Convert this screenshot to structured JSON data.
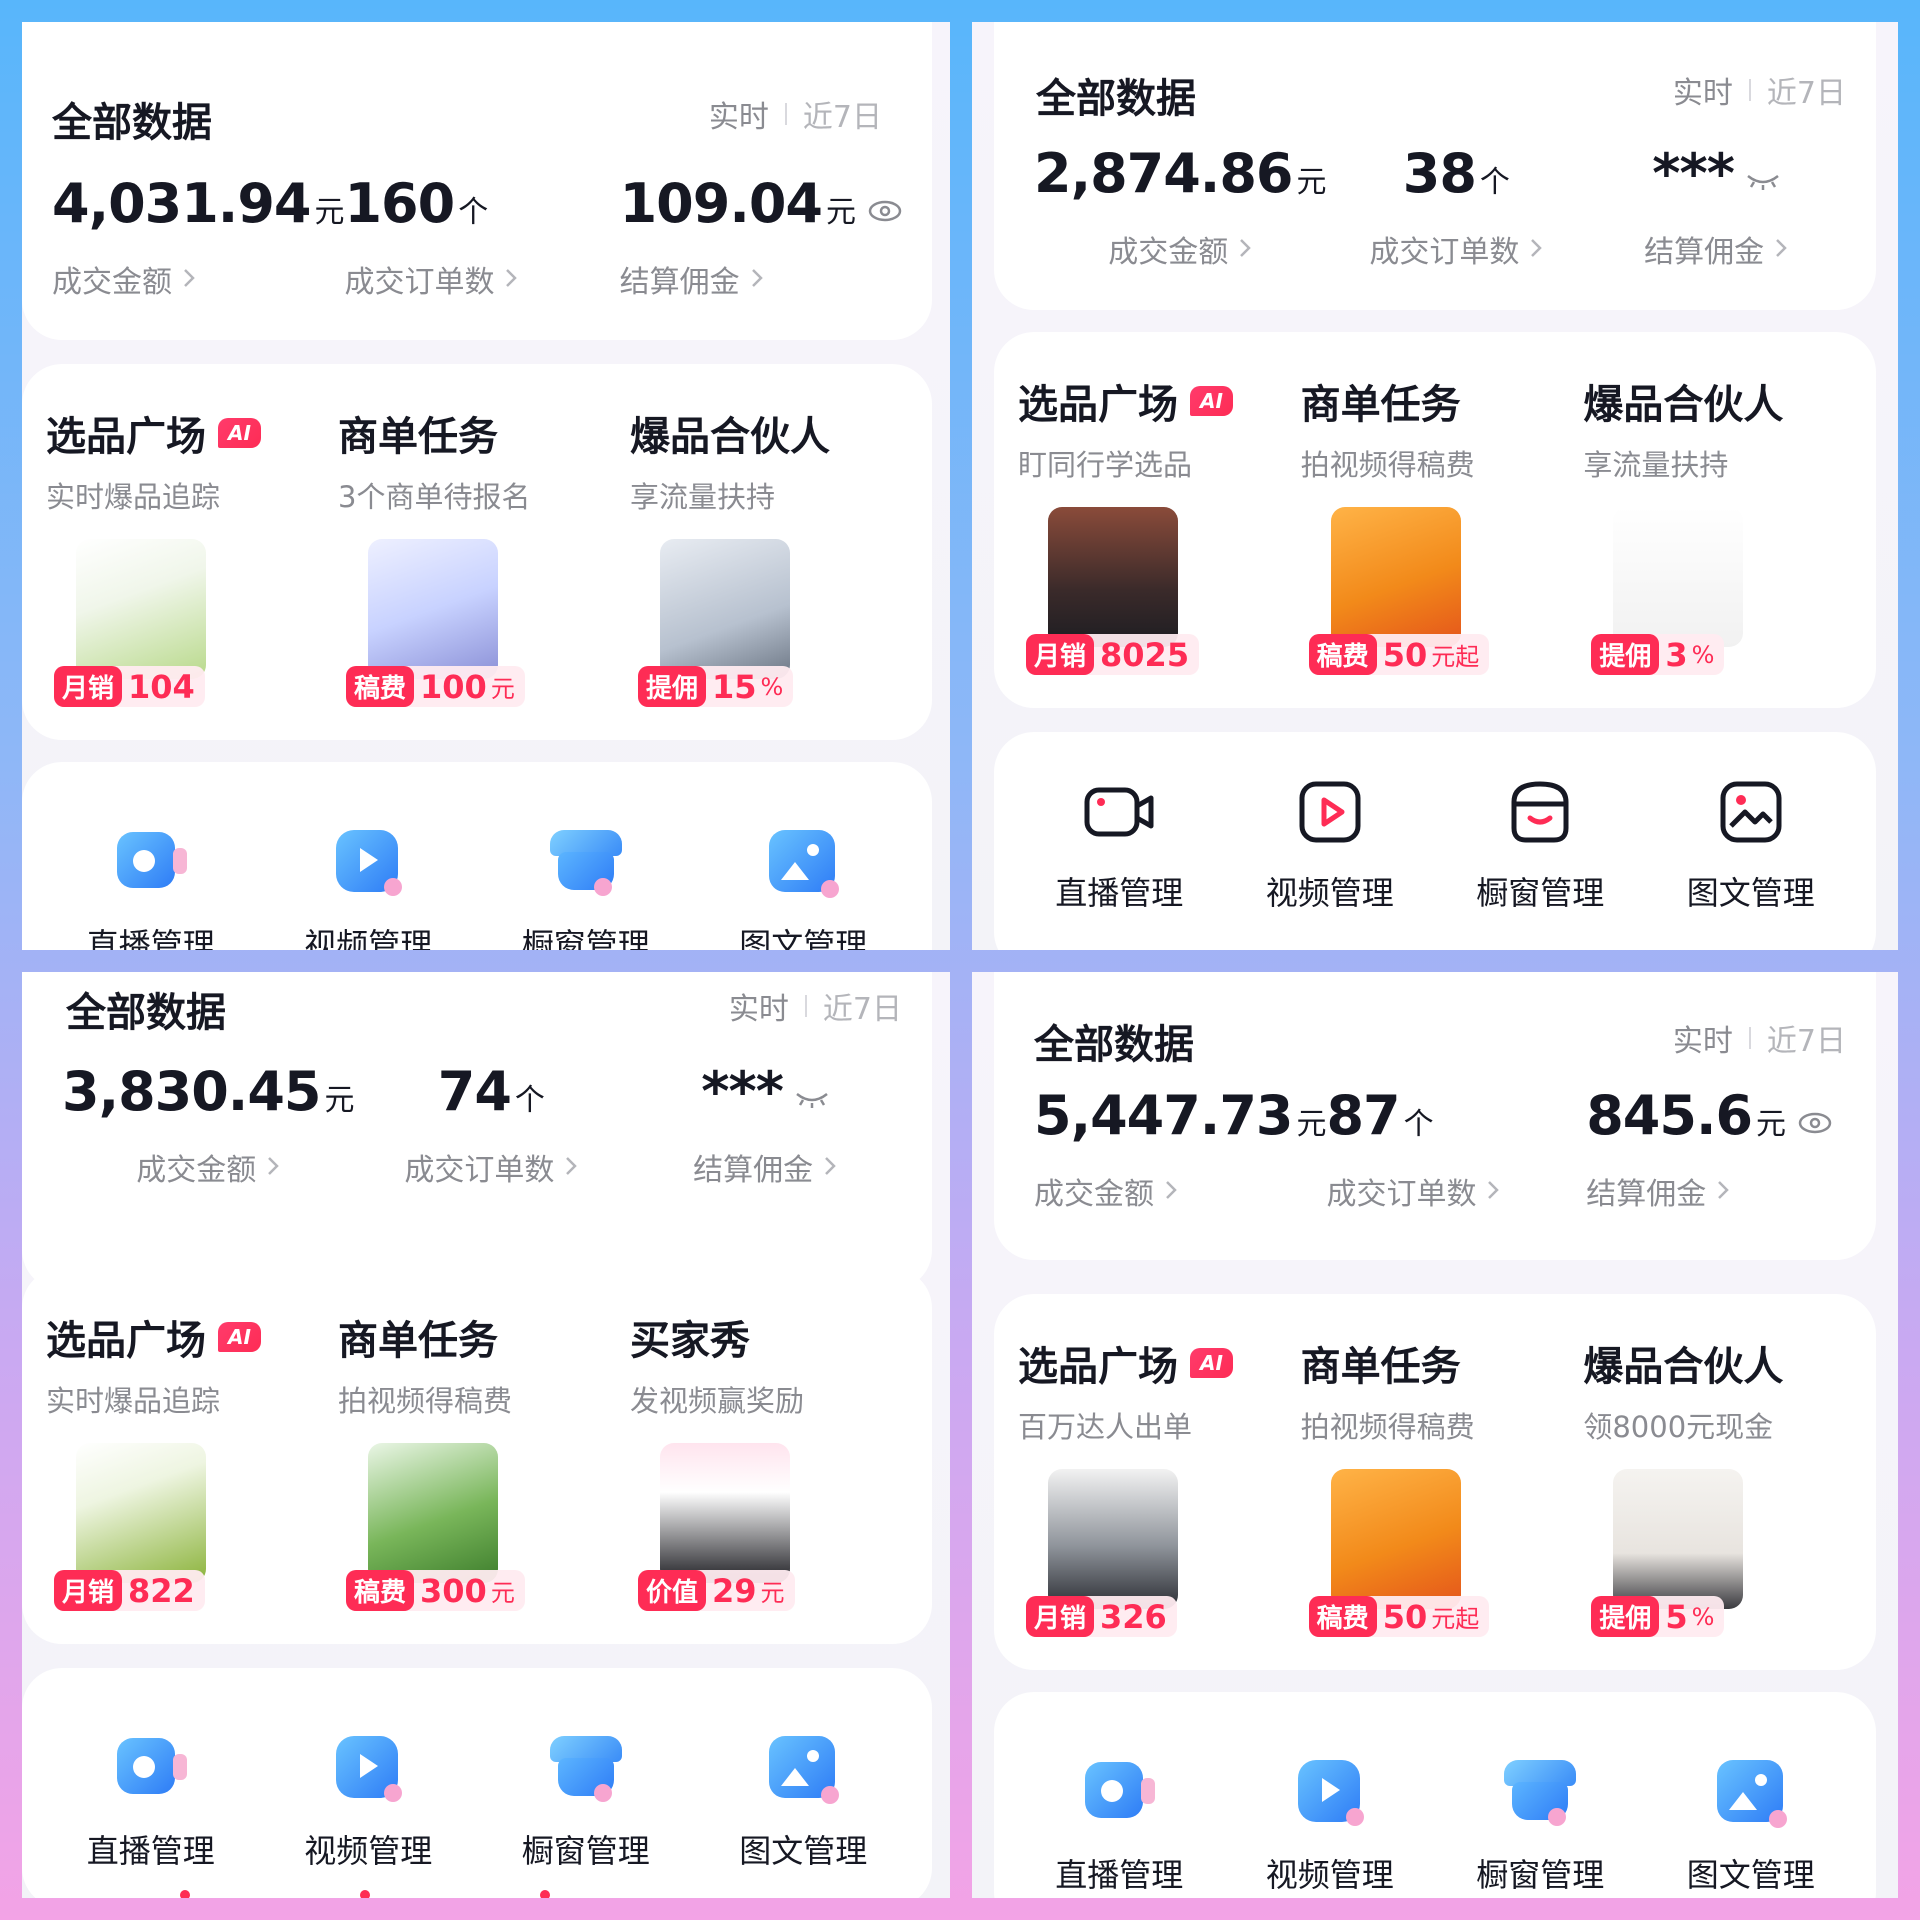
{
  "colors": {
    "accent": "#fe2c55",
    "text": "#161823",
    "muted": "#8a8b91"
  },
  "panels": [
    {
      "data_title": "全部数据",
      "period_realtime": "实时",
      "period_week": "近7日",
      "metrics": [
        {
          "value": "4,031.94",
          "unit": "元",
          "label": "成交金额"
        },
        {
          "value": "160",
          "unit": "个",
          "label": "成交订单数"
        },
        {
          "value": "109.04",
          "unit": "元",
          "label": "结算佣金",
          "icon": "eye-icon"
        }
      ],
      "features": [
        {
          "title": "选品广场",
          "badge": "AI",
          "subtitle": "实时爆品追踪",
          "tag_label": "月销",
          "tag_value": "104",
          "tag_unit": ""
        },
        {
          "title": "商单任务",
          "subtitle": "3个商单待报名",
          "tag_label": "稿费",
          "tag_value": "100",
          "tag_unit": "元"
        },
        {
          "title": "爆品合伙人",
          "subtitle": "享流量扶持",
          "tag_label": "提佣",
          "tag_value": "15",
          "tag_unit": "%"
        }
      ],
      "tools": [
        "直播管理",
        "视频管理",
        "橱窗管理",
        "图文管理"
      ]
    },
    {
      "data_title": "全部数据",
      "period_realtime": "实时",
      "period_week": "近7日",
      "metrics": [
        {
          "value": "2,874.86",
          "unit": "元",
          "label": "成交金额"
        },
        {
          "value": "38",
          "unit": "个",
          "label": "成交订单数"
        },
        {
          "value": "***",
          "unit": "",
          "label": "结算佣金",
          "icon": "eye-closed-icon"
        }
      ],
      "features": [
        {
          "title": "选品广场",
          "badge": "AI",
          "subtitle": "盯同行学选品",
          "tag_label": "月销",
          "tag_value": "8025",
          "tag_unit": ""
        },
        {
          "title": "商单任务",
          "subtitle": "拍视频得稿费",
          "tag_label": "稿费",
          "tag_value": "50",
          "tag_unit": "元起"
        },
        {
          "title": "爆品合伙人",
          "subtitle": "享流量扶持",
          "tag_label": "提佣",
          "tag_value": "3",
          "tag_unit": "%"
        }
      ],
      "tools": [
        "直播管理",
        "视频管理",
        "橱窗管理",
        "图文管理"
      ]
    },
    {
      "data_title": "全部数据",
      "period_realtime": "实时",
      "period_week": "近7日",
      "metrics": [
        {
          "value": "3,830.45",
          "unit": "元",
          "label": "成交金额"
        },
        {
          "value": "74",
          "unit": "个",
          "label": "成交订单数"
        },
        {
          "value": "***",
          "unit": "",
          "label": "结算佣金",
          "icon": "eye-closed-icon"
        }
      ],
      "features": [
        {
          "title": "选品广场",
          "badge": "AI",
          "subtitle": "实时爆品追踪",
          "tag_label": "月销",
          "tag_value": "822",
          "tag_unit": ""
        },
        {
          "title": "商单任务",
          "subtitle": "拍视频得稿费",
          "tag_label": "稿费",
          "tag_value": "300",
          "tag_unit": "元"
        },
        {
          "title": "买家秀",
          "subtitle": "发视频赢奖励",
          "tag_label": "价值",
          "tag_value": "29",
          "tag_unit": "元"
        }
      ],
      "tools": [
        "直播管理",
        "视频管理",
        "橱窗管理",
        "图文管理"
      ]
    },
    {
      "data_title": "全部数据",
      "period_realtime": "实时",
      "period_week": "近7日",
      "metrics": [
        {
          "value": "5,447.73",
          "unit": "元",
          "label": "成交金额"
        },
        {
          "value": "87",
          "unit": "个",
          "label": "成交订单数"
        },
        {
          "value": "845.6",
          "unit": "元",
          "label": "结算佣金",
          "icon": "eye-icon"
        }
      ],
      "features": [
        {
          "title": "选品广场",
          "badge": "AI",
          "subtitle": "百万达人出单",
          "tag_label": "月销",
          "tag_value": "326",
          "tag_unit": ""
        },
        {
          "title": "商单任务",
          "subtitle": "拍视频得稿费",
          "tag_label": "稿费",
          "tag_value": "50",
          "tag_unit": "元起"
        },
        {
          "title": "爆品合伙人",
          "subtitle": "领8000元现金",
          "tag_label": "提佣",
          "tag_value": "5",
          "tag_unit": "%"
        }
      ],
      "tools": [
        "直播管理",
        "视频管理",
        "橱窗管理",
        "图文管理"
      ]
    }
  ]
}
